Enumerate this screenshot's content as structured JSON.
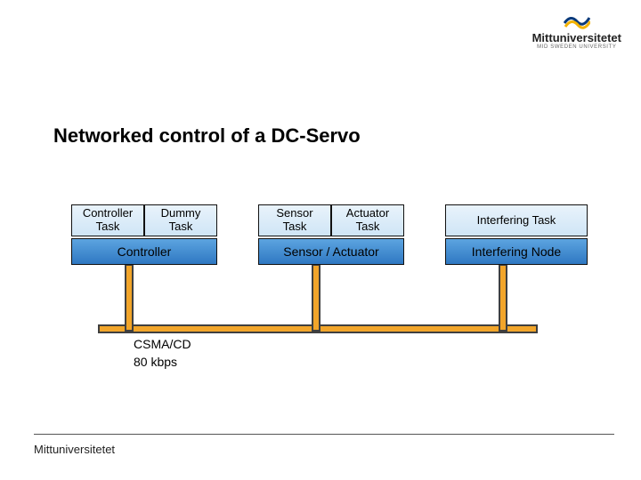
{
  "brand": {
    "name": "Mittuniversitetet",
    "sub": "MID SWEDEN UNIVERSITY"
  },
  "title": "Networked control of a DC-Servo",
  "tasks": {
    "controller": "Controller\nTask",
    "dummy": "Dummy\nTask",
    "sensor": "Sensor\nTask",
    "actuator": "Actuator\nTask",
    "interfering": "Interfering Task"
  },
  "nodes": {
    "controller": "Controller",
    "sensor_actuator": "Sensor / Actuator",
    "interfering": "Interfering Node"
  },
  "network": {
    "line1": "CSMA/CD",
    "line2": "80 kbps"
  },
  "footer": "Mittuniversitetet",
  "colors": {
    "task_bg": "#d9ecf8",
    "node_bg": "#3d87cc",
    "bus": "#f2a52a"
  }
}
